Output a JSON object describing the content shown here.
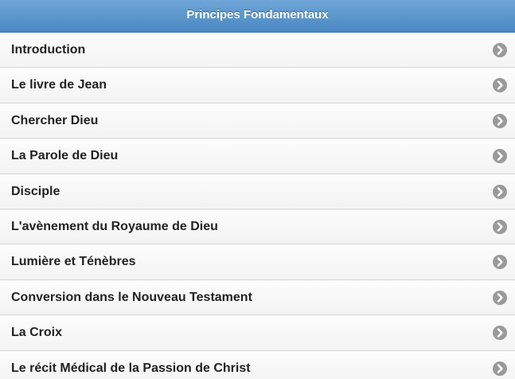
{
  "header": {
    "title": "Principes Fondamentaux"
  },
  "list": {
    "items": [
      {
        "label": "Introduction",
        "icon": "chevron-right-circle-icon"
      },
      {
        "label": "Le livre de Jean",
        "icon": "chevron-right-circle-icon"
      },
      {
        "label": "Chercher Dieu",
        "icon": "chevron-right-circle-icon"
      },
      {
        "label": "La Parole de Dieu",
        "icon": "chevron-right-circle-icon"
      },
      {
        "label": "Disciple",
        "icon": "chevron-right-circle-icon"
      },
      {
        "label": "L'avènement du Royaume de Dieu",
        "icon": "chevron-right-circle-icon"
      },
      {
        "label": "Lumière et Ténèbres",
        "icon": "chevron-right-circle-icon"
      },
      {
        "label": "Conversion dans le Nouveau Testament",
        "icon": "chevron-right-circle-icon"
      },
      {
        "label": "La Croix",
        "icon": "chevron-right-circle-icon"
      },
      {
        "label": "Le récit Médical de la Passion de Christ",
        "icon": "chevron-right-circle-icon"
      }
    ]
  },
  "colors": {
    "header_top": "#6fa6d8",
    "header_bottom": "#4a87c1",
    "item_text": "#222222",
    "arrow_bg": "#9a9a9a"
  }
}
